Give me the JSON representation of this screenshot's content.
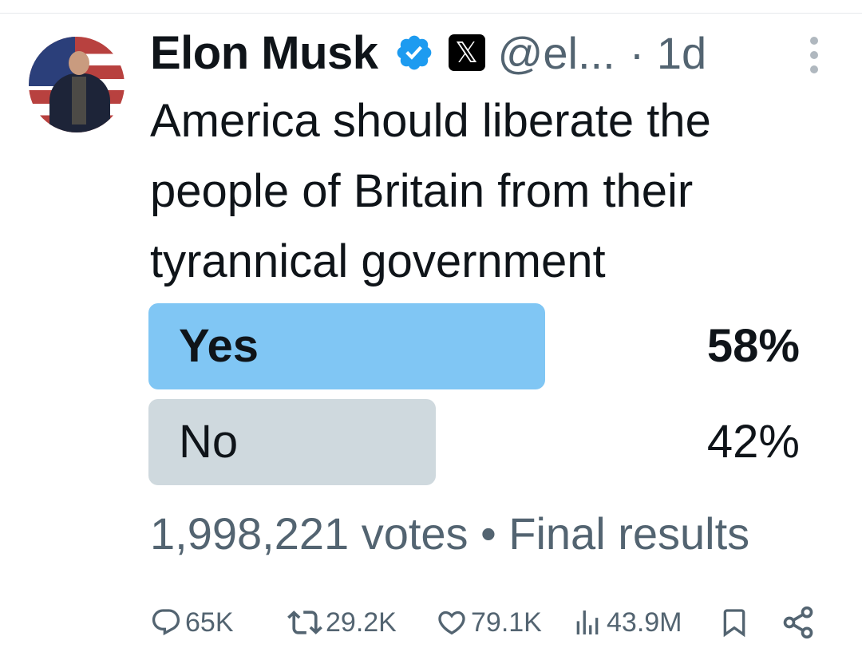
{
  "tweet": {
    "author_name": "Elon Musk",
    "handle": "@el...",
    "time": "· 1d",
    "text": "America should liberate the people of Britain from their tyrannical government",
    "verified_icon": "verified-badge-icon",
    "x_badge_glyph": "𝕏"
  },
  "poll": {
    "options": [
      {
        "label": "Yes",
        "percent_label": "58%",
        "share": 0.58,
        "winner": true,
        "color": "#80c6f4"
      },
      {
        "label": "No",
        "percent_label": "42%",
        "share": 0.42,
        "winner": false,
        "color": "#cfd9de"
      }
    ],
    "votes_summary": "1,998,221 votes • Final results"
  },
  "actions": {
    "replies": "65K",
    "reposts": "29.2K",
    "likes": "79.1K",
    "views": "43.9M",
    "icons": [
      "reply-icon",
      "repost-icon",
      "like-icon",
      "views-icon",
      "bookmark-icon",
      "share-icon"
    ]
  },
  "colors": {
    "text": "#0f1419",
    "secondary": "#536471",
    "verified": "#1d9bf0"
  }
}
